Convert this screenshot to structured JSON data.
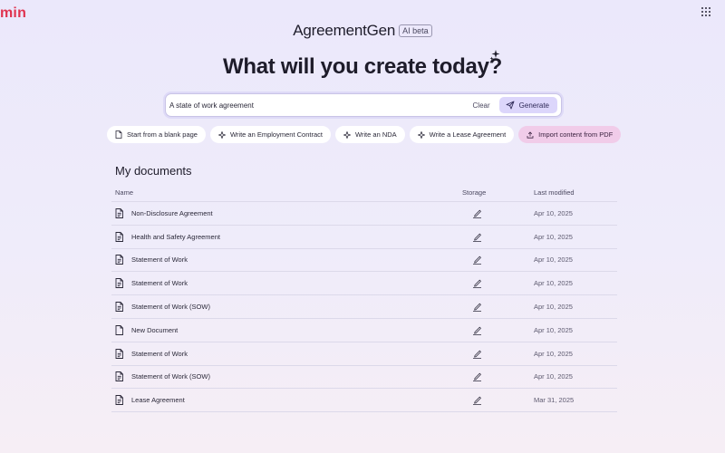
{
  "corner_logo": "min",
  "brand": {
    "name": "AgreementGen",
    "badge": "AI beta"
  },
  "hero": {
    "title": "What will you create today?"
  },
  "search": {
    "value": "A state of work agreement",
    "clear_label": "Clear",
    "generate_label": "Generate"
  },
  "chips": [
    {
      "label": "Start from a blank page",
      "icon": "file-icon"
    },
    {
      "label": "Write an Employment Contract",
      "icon": "sparkle-icon"
    },
    {
      "label": "Write an NDA",
      "icon": "sparkle-icon"
    },
    {
      "label": "Write a Lease Agreement",
      "icon": "sparkle-icon"
    },
    {
      "label": "Import content from PDF",
      "icon": "upload-icon"
    }
  ],
  "documents": {
    "title": "My documents",
    "columns": {
      "name": "Name",
      "storage": "Storage",
      "modified": "Last modified"
    },
    "rows": [
      {
        "name": "Non-Disclosure Agreement",
        "modified": "Apr 10, 2025",
        "storage_icon": "signature-pen-icon"
      },
      {
        "name": "Health and Safety Agreement",
        "modified": "Apr 10, 2025",
        "storage_icon": "signature-pen-icon"
      },
      {
        "name": "Statement of Work",
        "modified": "Apr 10, 2025",
        "storage_icon": "signature-pen-icon"
      },
      {
        "name": "Statement of Work",
        "modified": "Apr 10, 2025",
        "storage_icon": "signature-pen-icon"
      },
      {
        "name": "Statement of Work (SOW)",
        "modified": "Apr 10, 2025",
        "storage_icon": "signature-pen-icon"
      },
      {
        "name": "New Document",
        "modified": "Apr 10, 2025",
        "storage_icon": "signature-pen-icon"
      },
      {
        "name": "Statement of Work",
        "modified": "Apr 10, 2025",
        "storage_icon": "signature-pen-icon"
      },
      {
        "name": "Statement of Work (SOW)",
        "modified": "Apr 10, 2025",
        "storage_icon": "signature-pen-icon"
      },
      {
        "name": "Lease Agreement",
        "modified": "Mar 31, 2025",
        "storage_icon": "signature-pen-icon"
      }
    ]
  },
  "colors": {
    "accent": "#dcd6fb",
    "import_chip": "#f1cce9",
    "corner_logo": "#e0334f"
  }
}
